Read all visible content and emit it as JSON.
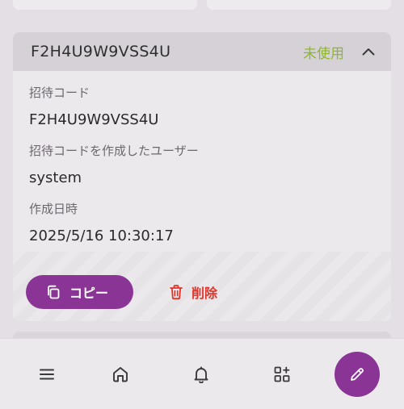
{
  "invite": {
    "code": "F2H4U9W9VSS4U",
    "status": "未使用",
    "fields": {
      "code_label": "招待コード",
      "code_value": "F2H4U9W9VSS4U",
      "creator_label": "招待コードを作成したユーザー",
      "creator_value": "system",
      "created_label": "作成日時",
      "created_value": "2025/5/16 10:30:17"
    },
    "actions": {
      "copy_label": "コピー",
      "delete_label": "削除"
    }
  },
  "colors": {
    "accent": "#8a3596",
    "status_unused": "#8cb82a",
    "danger": "#e0342a"
  },
  "nav": {
    "items": [
      "menu-icon",
      "home-icon",
      "bell-icon",
      "apps-add-icon"
    ],
    "fab_icon": "pencil-icon"
  }
}
